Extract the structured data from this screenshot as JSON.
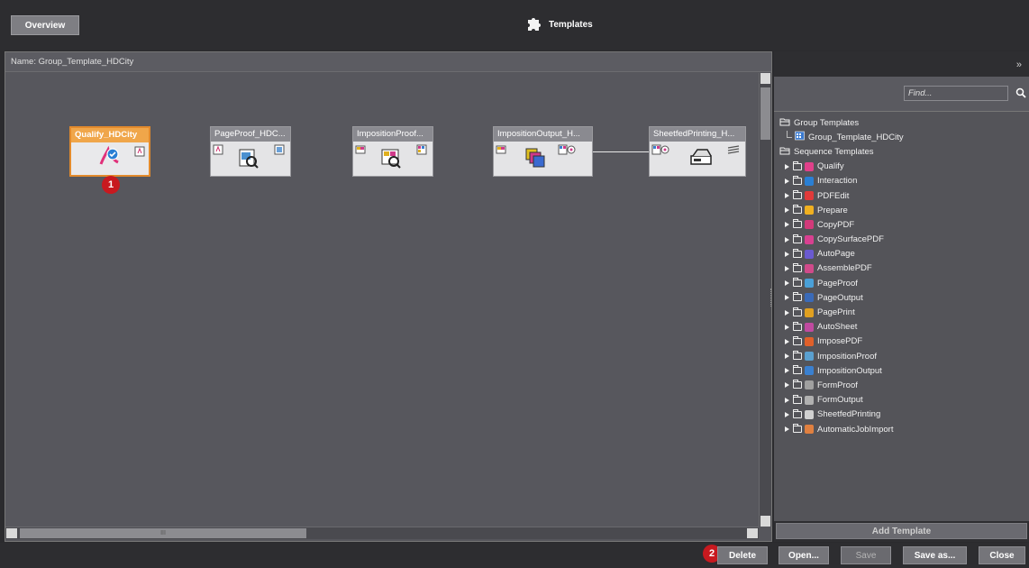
{
  "header": {
    "overview_label": "Overview",
    "title": "Templates"
  },
  "canvas": {
    "name_label": "Name: Group_Template_HDCity",
    "hscroll_grip": "III",
    "nodes": [
      {
        "title": "Qualify_HDCity",
        "selected": true
      },
      {
        "title": "PageProof_HDC...",
        "selected": false
      },
      {
        "title": "ImpositionProof...",
        "selected": false
      },
      {
        "title": "ImpositionOutput_H...",
        "selected": false
      },
      {
        "title": "SheetfedPrinting_H...",
        "selected": false
      }
    ]
  },
  "badges": {
    "step1": "1",
    "step2": "2"
  },
  "panel": {
    "expand_glyph": "»",
    "find_placeholder": "Find...",
    "group_header": "Group Templates",
    "group_item": "Group_Template_HDCity",
    "sequence_header": "Sequence Templates",
    "sequence_items": [
      {
        "label": "Qualify",
        "color": "#e0408a"
      },
      {
        "label": "Interaction",
        "color": "#2a7fd4"
      },
      {
        "label": "PDFEdit",
        "color": "#e03a3a"
      },
      {
        "label": "Prepare",
        "color": "#f0b020"
      },
      {
        "label": "CopyPDF",
        "color": "#d23a7a"
      },
      {
        "label": "CopySurfacePDF",
        "color": "#d84090"
      },
      {
        "label": "AutoPage",
        "color": "#6a5ad0"
      },
      {
        "label": "AssemblePDF",
        "color": "#d04a8a"
      },
      {
        "label": "PageProof",
        "color": "#4aa0d8"
      },
      {
        "label": "PageOutput",
        "color": "#3a6ab8"
      },
      {
        "label": "PagePrint",
        "color": "#e0a020"
      },
      {
        "label": "AutoSheet",
        "color": "#c04aa0"
      },
      {
        "label": "ImposePDF",
        "color": "#e0602a"
      },
      {
        "label": "ImpositionProof",
        "color": "#5aa0d0"
      },
      {
        "label": "ImpositionOutput",
        "color": "#3a80d0"
      },
      {
        "label": "FormProof",
        "color": "#a0a0a0"
      },
      {
        "label": "FormOutput",
        "color": "#b0b0b0"
      },
      {
        "label": "SheetfedPrinting",
        "color": "#d0d0d0"
      },
      {
        "label": "AutomaticJobImport",
        "color": "#e08040"
      }
    ],
    "add_template_label": "Add Template"
  },
  "footer": {
    "delete_label": "Delete",
    "open_label": "Open...",
    "save_label": "Save",
    "save_as_label": "Save as...",
    "close_label": "Close"
  },
  "colors": {
    "selected_border": "#e28a2c",
    "badge": "#c8191f"
  }
}
